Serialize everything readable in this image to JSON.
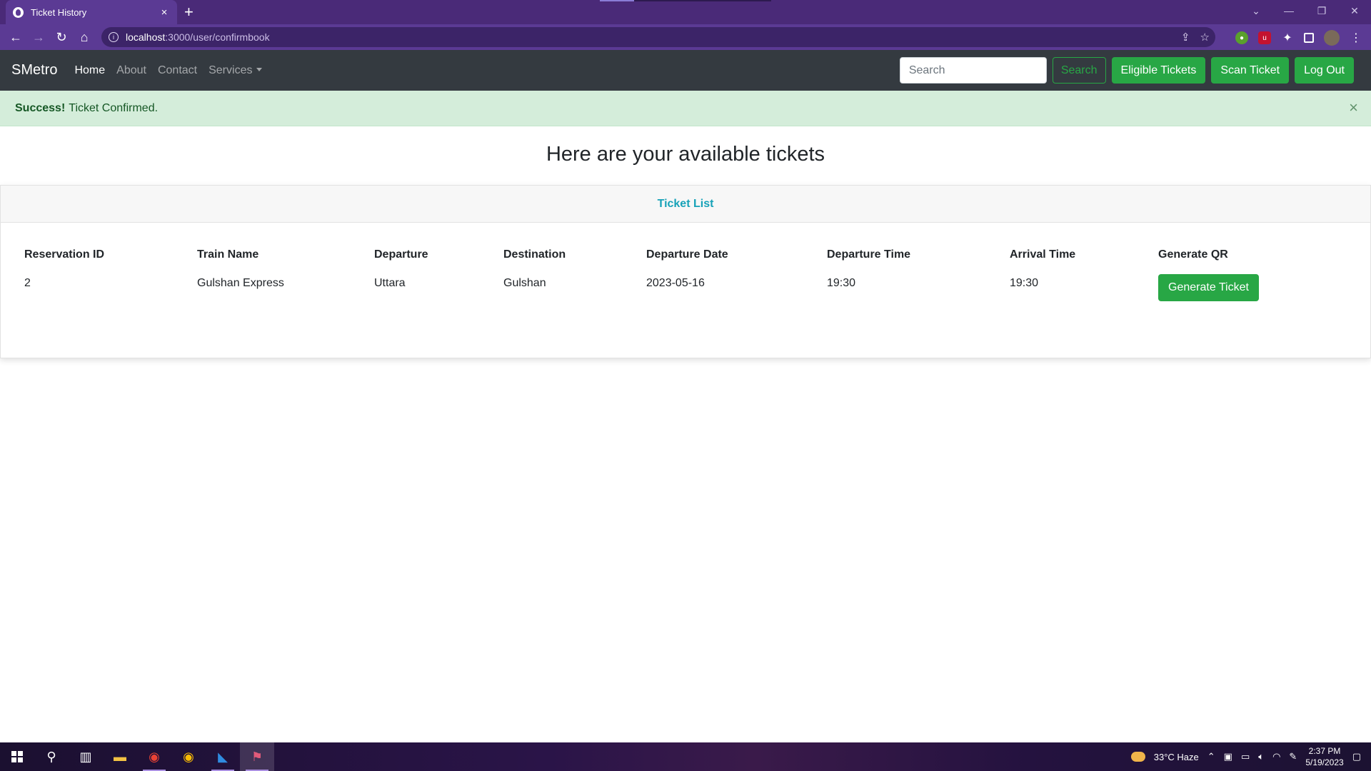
{
  "browser": {
    "tab_title": "Ticket History",
    "tab_close": "×",
    "new_tab": "+",
    "url_host": "localhost",
    "url_path": ":3000/user/confirmbook"
  },
  "navbar": {
    "brand": "SMetro",
    "links": [
      "Home",
      "About",
      "Contact",
      "Services"
    ],
    "search_placeholder": "Search",
    "search_button": "Search",
    "eligible_button": "Eligible Tickets",
    "scan_button": "Scan Ticket",
    "logout_button": "Log Out"
  },
  "alert": {
    "strong": "Success!",
    "message": "Ticket Confirmed.",
    "close": "×"
  },
  "page": {
    "heading": "Here are your available tickets",
    "card_header": "Ticket List"
  },
  "table": {
    "headers": [
      "Reservation ID",
      "Train Name",
      "Departure",
      "Destination",
      "Departure Date",
      "Departure Time",
      "Arrival Time",
      "Generate QR"
    ],
    "rows": [
      {
        "reservation_id": "2",
        "train_name": "Gulshan Express",
        "departure": "Uttara",
        "destination": "Gulshan",
        "departure_date": "2023-05-16",
        "departure_time": "19:30",
        "arrival_time": "19:30",
        "action": "Generate Ticket"
      }
    ]
  },
  "taskbar": {
    "weather": "33°C  Haze",
    "time": "2:37 PM",
    "date": "5/19/2023"
  },
  "colors": {
    "success": "#28a745",
    "info": "#17a2b8",
    "navbar": "#343a40",
    "alert_bg": "#d4edda",
    "browser_frame": "#5b3a94"
  }
}
